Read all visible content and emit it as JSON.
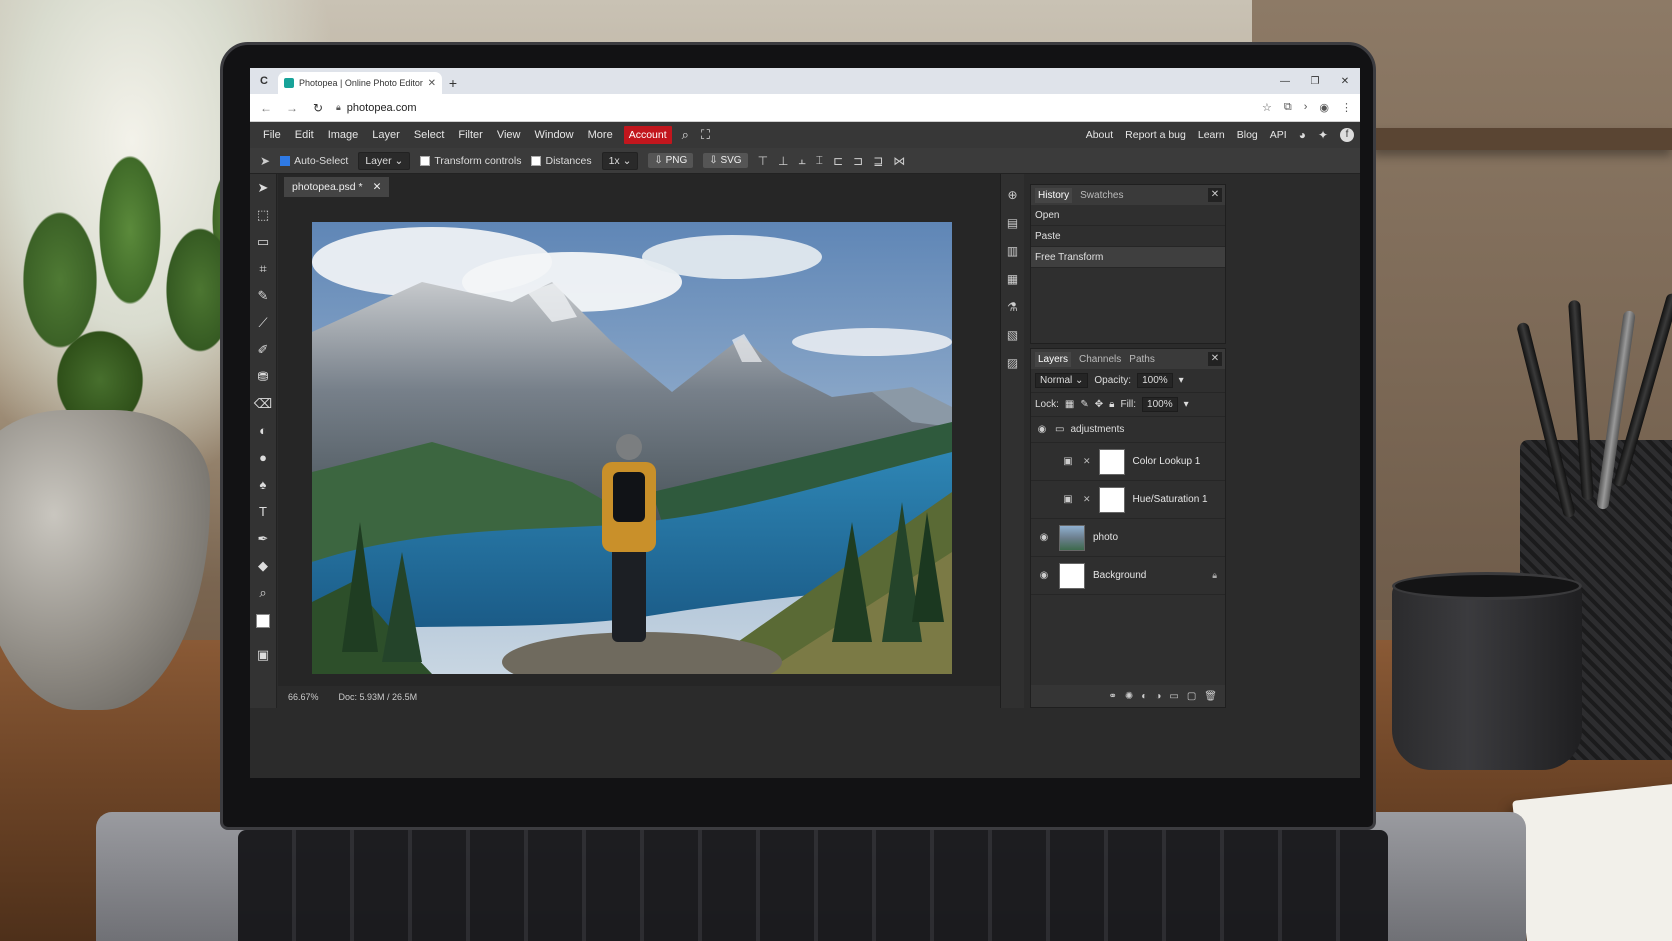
{
  "browser": {
    "tab_title": "Photopea | Online Photo Editor",
    "url": "photopea.com"
  },
  "menu": {
    "items": [
      "File",
      "Edit",
      "Image",
      "Layer",
      "Select",
      "Filter",
      "View",
      "Window",
      "More"
    ],
    "account": "Account",
    "right_links": [
      "About",
      "Report a bug",
      "Learn",
      "Blog",
      "API"
    ]
  },
  "options": {
    "auto_select": "Auto-Select",
    "layer_select": "Layer",
    "transform_controls": "Transform controls",
    "distances": "Distances",
    "zoom_select": "1x",
    "png_btn": "PNG",
    "svg_btn": "SVG"
  },
  "document": {
    "tab_name": "photopea.psd *",
    "zoom": "66.67%",
    "doc_size": "Doc: 5.93M / 26.5M"
  },
  "history_panel": {
    "tabs": [
      "History",
      "Swatches"
    ],
    "items": [
      "Open",
      "Paste",
      "Free Transform"
    ],
    "active_index": 2
  },
  "layers_panel": {
    "tabs": [
      "Layers",
      "Channels",
      "Paths"
    ],
    "blend_mode": "Normal",
    "opacity_label": "Opacity:",
    "opacity_value": "100%",
    "lock_label": "Lock:",
    "fill_label": "Fill:",
    "fill_value": "100%",
    "layers": [
      {
        "name": "adjustments",
        "type": "group"
      },
      {
        "name": "Color Lookup 1",
        "type": "adjustment"
      },
      {
        "name": "Hue/Saturation 1",
        "type": "adjustment"
      },
      {
        "name": "photo",
        "type": "image"
      },
      {
        "name": "Background",
        "type": "background"
      }
    ]
  },
  "colors": {
    "account_red": "#c2161d",
    "ui_dark": "#2b2b2b",
    "accent_blue": "#2f7ae5"
  }
}
